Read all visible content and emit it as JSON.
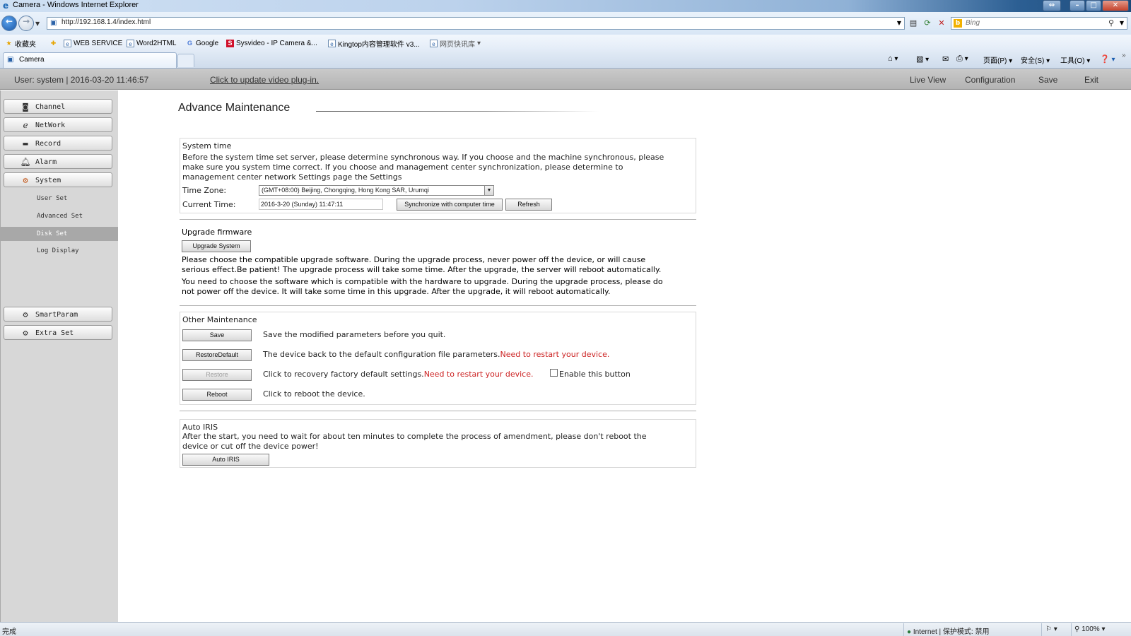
{
  "browser": {
    "window_title": "Camera - Windows Internet Explorer",
    "url": "http://192.168.1.4/index.html",
    "search_placeholder": "Bing",
    "favorites": {
      "label": "收藏夹",
      "links": [
        "WEB SERVICE",
        "Word2HTML",
        "Google",
        "Sysvideo - IP Camera &...",
        "Kingtop内容管理软件 v3...",
        "网页快讯库"
      ]
    },
    "tab": "Camera",
    "commands": {
      "page": "页面(P)",
      "safety": "安全(S)",
      "tools": "工具(O)"
    },
    "status": {
      "left": "完成",
      "zone": "Internet | 保护模式: 禁用",
      "zoom": "100%"
    }
  },
  "header": {
    "user_info": "User: system | 2016-03-20 11:46:57",
    "plugin_link": "Click to update video plug-in.",
    "nav": {
      "live_view": "Live View",
      "configuration": "Configuration",
      "save": "Save",
      "exit": "Exit"
    }
  },
  "sidebar": {
    "channel": "Channel",
    "network": "NetWork",
    "record": "Record",
    "alarm": "Alarm",
    "system": "System",
    "sub": {
      "user_set": "User Set",
      "advanced_set": "Advanced Set",
      "disk_set": "Disk Set",
      "log_display": "Log Display"
    },
    "smartparam": "SmartParam",
    "extra_set": "Extra Set"
  },
  "page_title": "Advance Maintenance",
  "system_time": {
    "title": "System time",
    "desc_1": "Before the system time set server, please determine synchronous way. If you choose and the machine synchronous, please",
    "desc_2": "make sure you system time correct. If you choose and management center synchronization, please determine to",
    "desc_3": "management center network Settings page the Settings",
    "tz_label": "Time Zone:",
    "tz_value": "(GMT+08:00) Beijing, Chongqing, Hong Kong SAR, Urumqi",
    "ct_label": "Current Time:",
    "ct_value": "2016-3-20 (Sunday) 11:47:11",
    "sync_btn": "Synchronize with computer time",
    "refresh_btn": "Refresh"
  },
  "upgrade": {
    "title": "Upgrade firmware",
    "button": "Upgrade System",
    "p1_1": "Please choose the compatible upgrade software. During the upgrade process, never power off the device, or will cause",
    "p1_2": "serious effect.Be patient! The upgrade process will take some time. After the upgrade, the server will reboot automatically.",
    "p2_1": "You need to choose the software which is compatible with the hardware to upgrade. During the upgrade process, please do",
    "p2_2": "not power off the device. It will take some time in this upgrade. After the upgrade, it will reboot automatically."
  },
  "other": {
    "title": "Other Maintenance",
    "save_btn": "Save",
    "save_desc": "Save the modified parameters before you quit.",
    "restore_default_btn": "RestoreDefault",
    "restore_default_desc": "The device back to the default configuration file parameters.",
    "restart_warning": "Need to restart your device.",
    "restore_btn": "Restore",
    "restore_desc": "Click to recovery factory default settings.",
    "enable_label": "Enable this button",
    "reboot_btn": "Reboot",
    "reboot_desc": "Click to reboot the device."
  },
  "auto_iris": {
    "title": "Auto IRIS",
    "desc_1": "After the start, you need to wait for about ten minutes to complete the process of amendment, please don't reboot the",
    "desc_2": "device or cut off the device power!",
    "button": "Auto IRIS"
  }
}
